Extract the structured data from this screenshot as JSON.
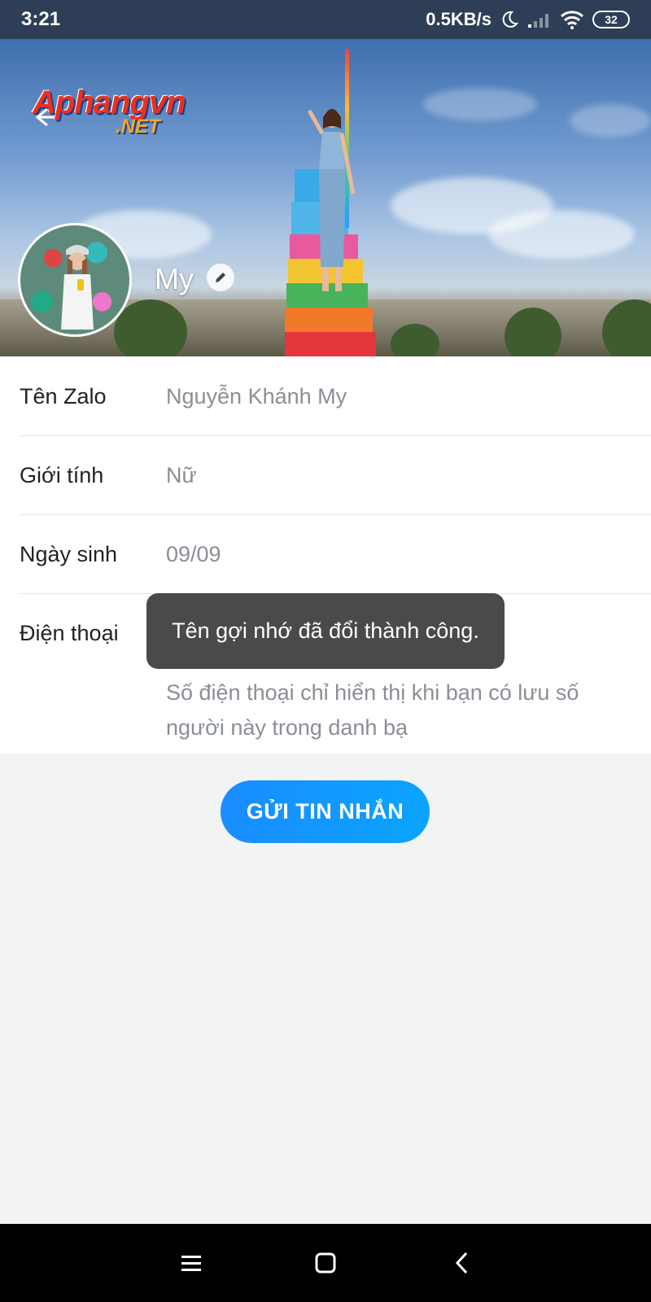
{
  "status_bar": {
    "time": "3:21",
    "speed": "0.5KB/s",
    "battery": "32"
  },
  "header": {
    "logo_main": "Aphangvn",
    "logo_sub": ".NET",
    "profile_name": "My"
  },
  "info": {
    "rows": [
      {
        "label": "Tên Zalo",
        "value": "Nguyễn Khánh My"
      },
      {
        "label": "Giới tính",
        "value": "Nữ"
      },
      {
        "label": "Ngày sinh",
        "value": "09/09"
      },
      {
        "label": "Điện thoại",
        "value": ""
      }
    ],
    "phone_note": "Số điện thoại chỉ hiển thị khi bạn có lưu số người này trong danh bạ"
  },
  "toast": {
    "message": "Tên gợi nhớ đã đổi thành công."
  },
  "actions": {
    "send_message": "GỬI TIN NHẮN"
  },
  "colors": {
    "accent": "#0a95ff",
    "toast_bg": "#4a4a4a",
    "status_bar_bg": "#2f3e57"
  },
  "icons": {
    "back": "arrow-left-icon",
    "edit": "pencil-icon",
    "nav_menu": "menu-icon",
    "nav_home": "square-icon",
    "nav_back": "chevron-left-icon"
  }
}
